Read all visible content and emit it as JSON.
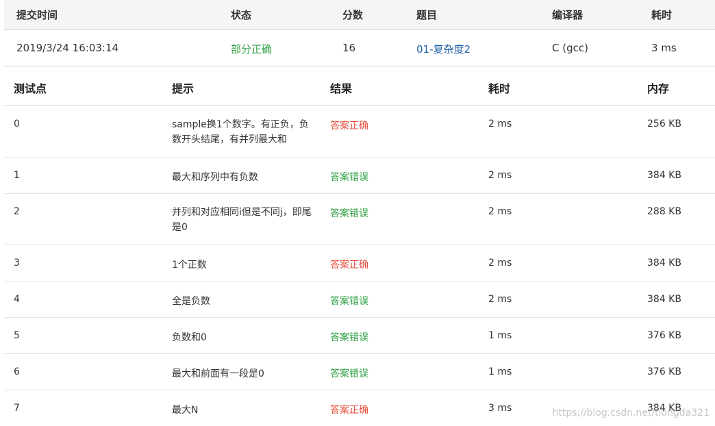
{
  "summary": {
    "headers": {
      "time": "提交时间",
      "status": "状态",
      "score": "分数",
      "problem": "题目",
      "compiler": "编译器",
      "duration": "耗时"
    },
    "row": {
      "time": "2019/3/24 16:03:14",
      "status": "部分正确",
      "score": "16",
      "problem": "01-复杂度2",
      "compiler": "C (gcc)",
      "duration": "3 ms"
    }
  },
  "cases": {
    "headers": {
      "case": "测试点",
      "hint": "提示",
      "result": "结果",
      "time": "耗时",
      "memory": "内存"
    },
    "rows": [
      {
        "id": "0",
        "hint": "sample换1个数字。有正负，负数开头结尾，有并列最大和",
        "result": "答案正确",
        "time": "2 ms",
        "memory": "256 KB"
      },
      {
        "id": "1",
        "hint": "最大和序列中有负数",
        "result": "答案错误",
        "time": "2 ms",
        "memory": "384 KB"
      },
      {
        "id": "2",
        "hint": "并列和对应相同i但是不同j，即尾是0",
        "result": "答案错误",
        "time": "2 ms",
        "memory": "288 KB"
      },
      {
        "id": "3",
        "hint": "1个正数",
        "result": "答案正确",
        "time": "2 ms",
        "memory": "384 KB"
      },
      {
        "id": "4",
        "hint": "全是负数",
        "result": "答案错误",
        "time": "2 ms",
        "memory": "384 KB"
      },
      {
        "id": "5",
        "hint": "负数和0",
        "result": "答案错误",
        "time": "1 ms",
        "memory": "376 KB"
      },
      {
        "id": "6",
        "hint": "最大和前面有一段是0",
        "result": "答案错误",
        "time": "1 ms",
        "memory": "376 KB"
      },
      {
        "id": "7",
        "hint": "最大N",
        "result": "答案正确",
        "time": "3 ms",
        "memory": "384 KB"
      }
    ]
  },
  "colors": {
    "accepted": "#e74c3c",
    "wrong_answer": "#2ea043",
    "link": "#1f5fa8"
  },
  "watermark": "https://blog.csdn.net/tiongda321"
}
